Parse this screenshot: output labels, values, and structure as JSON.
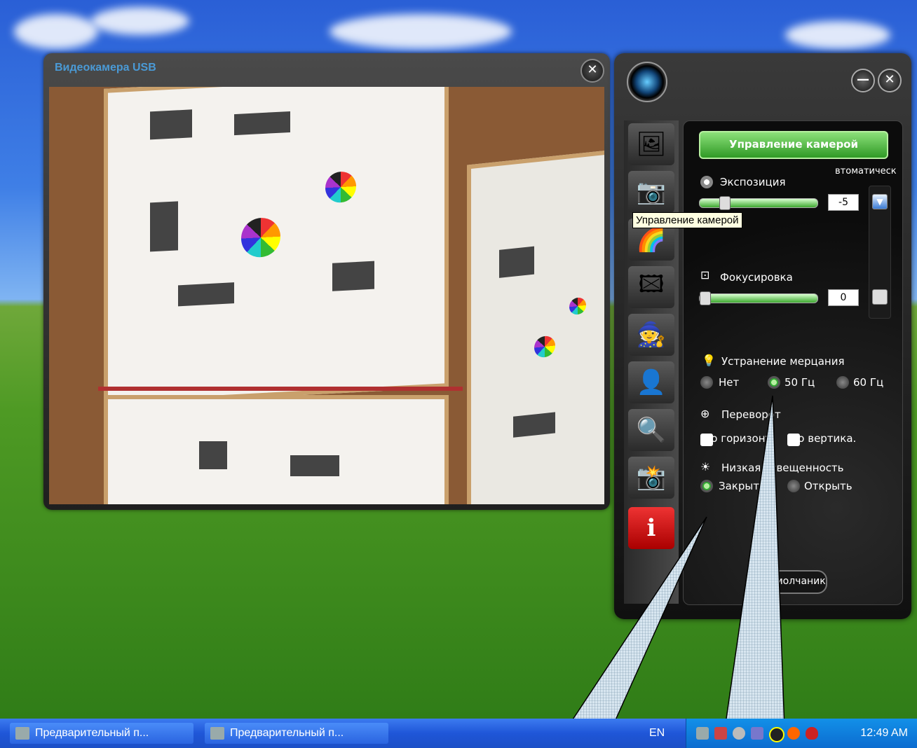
{
  "video_window": {
    "title": "Видеокамера USB",
    "close_glyph": "✕"
  },
  "panel": {
    "minimize_glyph": "—",
    "close_glyph": "✕",
    "header_button": "Управление камерой",
    "auto_label": "втоматическ",
    "exposure": {
      "label": "Экспозиция",
      "value": "-5",
      "slider_level": 0.18
    },
    "focus": {
      "label": "Фокусировка",
      "value": "0",
      "slider_level": 0.0
    },
    "flicker": {
      "label": "Устранение мерцания",
      "options": [
        "Нет",
        "50 Гц",
        "60 Гц"
      ],
      "selected": "50 Гц"
    },
    "flip": {
      "label": "Переворот",
      "horizontal": "По горизонт",
      "vertical": "По вертика."
    },
    "lowlight": {
      "label": "Низкая освещенность",
      "options": [
        "Закрыть",
        "Открыть"
      ],
      "selected": "Закрыть"
    },
    "default_button": "По умолчаник"
  },
  "sidebar_icons": [
    "image-icon",
    "camera-settings-icon",
    "color-icon",
    "frame-icon",
    "magic-hat-icon",
    "face-tracking-icon",
    "zoom-icon",
    "snapshot-icon",
    "info-icon"
  ],
  "tooltip": "Управление камерой",
  "taskbar": {
    "buttons": [
      "Предварительный п...",
      "Предварительный п..."
    ],
    "language": "EN",
    "clock": "12:49 AM"
  },
  "colors": {
    "accent_green": "#3ea830",
    "title_blue": "#4a9ad6",
    "taskbar_blue": "#1f56d8"
  }
}
